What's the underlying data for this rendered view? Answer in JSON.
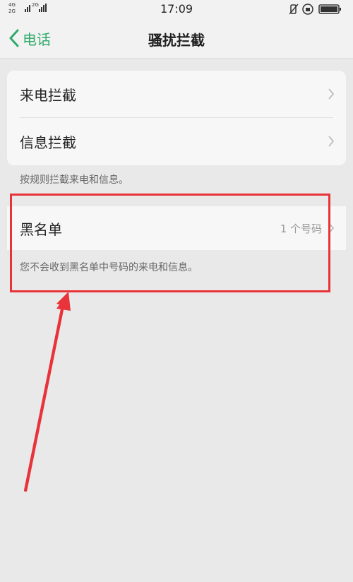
{
  "status_bar": {
    "net_top": "4G",
    "net_bottom": "2G",
    "net_mid": "2G",
    "time": "17:09"
  },
  "nav": {
    "back_label": "电话",
    "title": "骚扰拦截"
  },
  "interception": {
    "items": [
      {
        "label": "来电拦截"
      },
      {
        "label": "信息拦截"
      }
    ],
    "note": "按规则拦截来电和信息。"
  },
  "blacklist": {
    "label": "黑名单",
    "value": "1 个号码",
    "note": "您不会收到黑名单中号码的来电和信息。"
  },
  "colors": {
    "accent": "#2eaa6a",
    "annotation": "#e8333a"
  }
}
